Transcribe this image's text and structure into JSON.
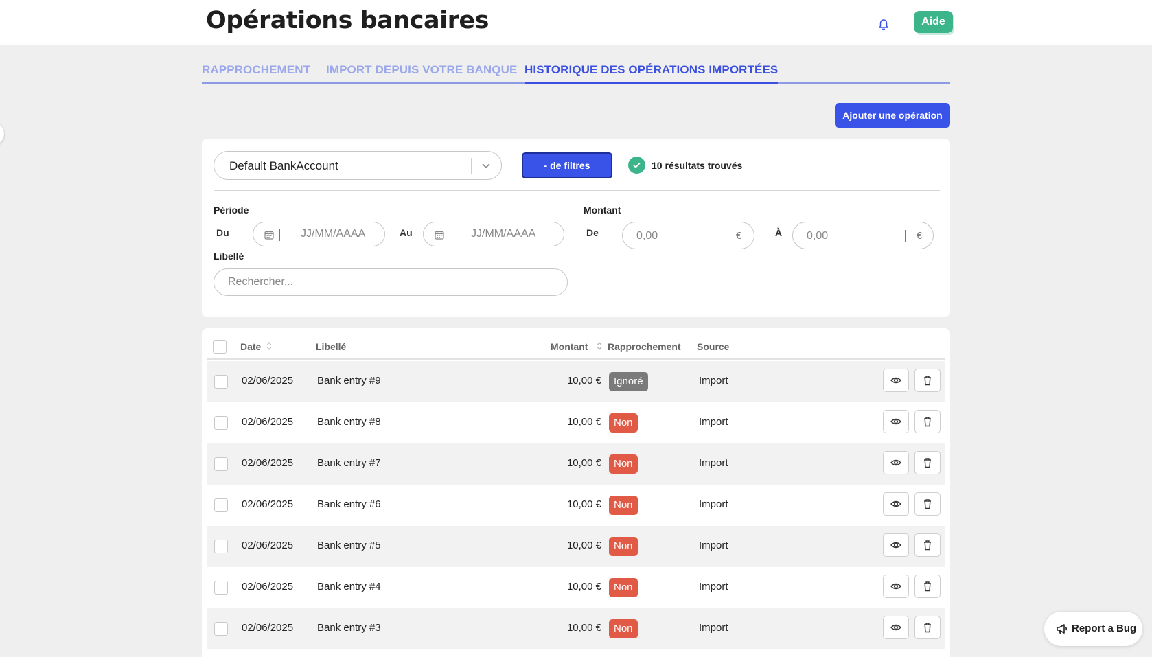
{
  "header": {
    "title": "Opérations bancaires",
    "help_label": "Aide"
  },
  "tabs": [
    {
      "label": "RAPPROCHEMENT",
      "active": false
    },
    {
      "label": "IMPORT DEPUIS VOTRE BANQUE",
      "active": false
    },
    {
      "label": "HISTORIQUE DES OPÉRATIONS IMPORTÉES",
      "active": true
    }
  ],
  "add_operation_label": "Ajouter une opération",
  "filters": {
    "account_value": "Default BankAccount",
    "toggle_label": "- de filtres",
    "results_text": "10 résultats trouvés",
    "period_label": "Période",
    "from_label": "Du",
    "to_label": "Au",
    "date_placeholder": "JJ/MM/AAAA",
    "amount_label": "Montant",
    "amount_from_label": "De",
    "amount_to_label": "À",
    "amount_placeholder": "0,00",
    "currency": "€",
    "label_label": "Libellé",
    "search_placeholder": "Rechercher..."
  },
  "table": {
    "headers": {
      "date": "Date",
      "label": "Libellé",
      "amount": "Montant",
      "reconciliation": "Rapprochement",
      "source": "Source"
    },
    "rows": [
      {
        "date": "02/06/2025",
        "label": "Bank entry #9",
        "amount": "10,00 €",
        "status": "Ignoré",
        "status_type": "ignored",
        "source": "Import"
      },
      {
        "date": "02/06/2025",
        "label": "Bank entry #8",
        "amount": "10,00 €",
        "status": "Non",
        "status_type": "no",
        "source": "Import"
      },
      {
        "date": "02/06/2025",
        "label": "Bank entry #7",
        "amount": "10,00 €",
        "status": "Non",
        "status_type": "no",
        "source": "Import"
      },
      {
        "date": "02/06/2025",
        "label": "Bank entry #6",
        "amount": "10,00 €",
        "status": "Non",
        "status_type": "no",
        "source": "Import"
      },
      {
        "date": "02/06/2025",
        "label": "Bank entry #5",
        "amount": "10,00 €",
        "status": "Non",
        "status_type": "no",
        "source": "Import"
      },
      {
        "date": "02/06/2025",
        "label": "Bank entry #4",
        "amount": "10,00 €",
        "status": "Non",
        "status_type": "no",
        "source": "Import"
      },
      {
        "date": "02/06/2025",
        "label": "Bank entry #3",
        "amount": "10,00 €",
        "status": "Non",
        "status_type": "no",
        "source": "Import"
      }
    ]
  },
  "report_bug_label": "Report a Bug",
  "icons": [
    "bell-icon",
    "chevron-down-icon",
    "check-icon",
    "calendar-icon",
    "sort-icon",
    "eye-icon",
    "trash-icon",
    "megaphone-icon"
  ],
  "colors": {
    "primary": "#3952e8",
    "success": "#3db58a",
    "danger": "#e05a45",
    "muted_badge": "#7a7a7a",
    "tab_inactive": "#9aa7ea"
  }
}
